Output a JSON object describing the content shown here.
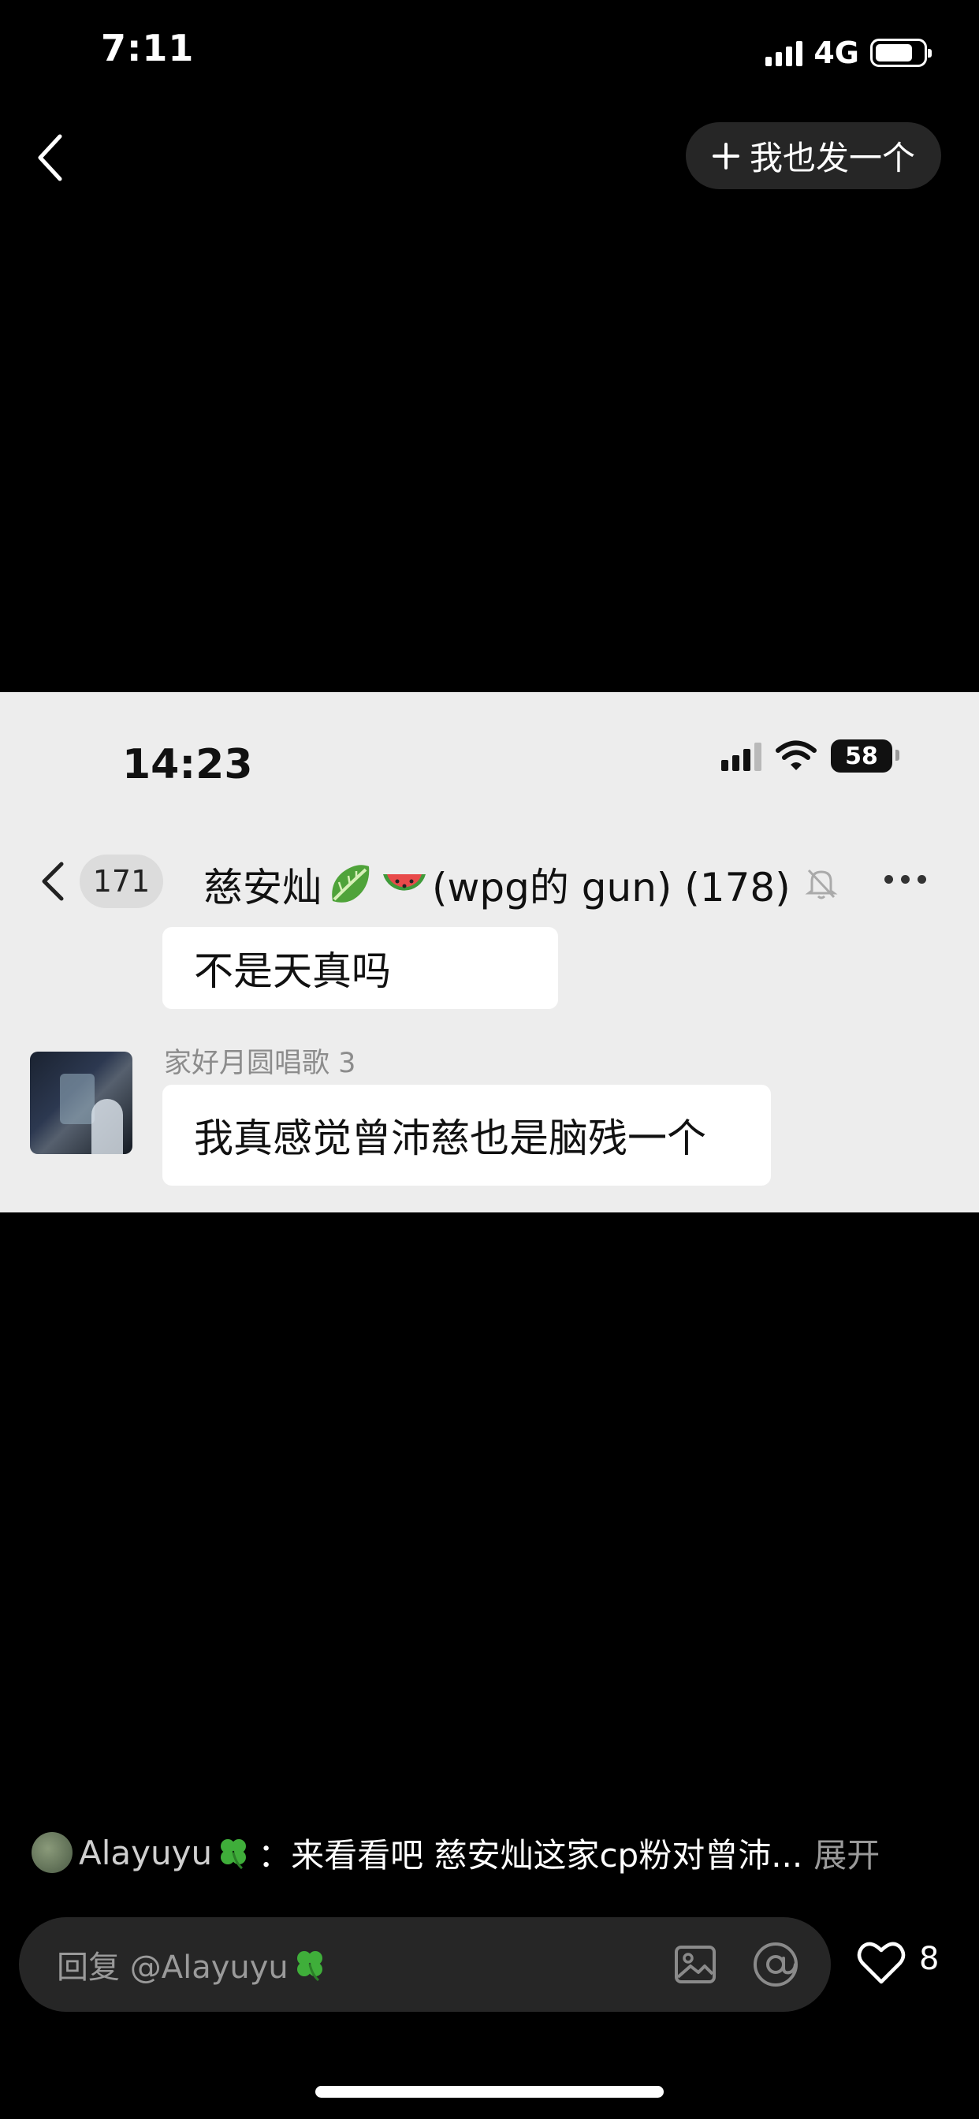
{
  "status_bar": {
    "time": "7:11",
    "network": "4G"
  },
  "nav": {
    "post_button_label": "我也发一个"
  },
  "screenshot": {
    "status": {
      "time": "14:23",
      "battery": "58"
    },
    "header": {
      "unread_count": "171",
      "group_name_prefix": "慈安灿",
      "group_name_suffix": "(wpg的 gun) (178)"
    },
    "messages": [
      {
        "text": "不是天真吗"
      },
      {
        "sender": "家好月圆唱歌 3",
        "text": "我真感觉曾沛慈也是脑残一个"
      }
    ]
  },
  "caption": {
    "username": "Alayuyu",
    "text": "：来看看吧 慈安灿这家cp粉对曾沛...",
    "expand_label": "展开"
  },
  "reply": {
    "placeholder_prefix": "回复 @Alayuyu"
  },
  "likes": {
    "count": "8"
  },
  "icons": [
    "back-icon",
    "plus-icon",
    "wifi-icon",
    "mute-bell-icon",
    "more-icon",
    "clover-icon",
    "image-icon",
    "at-icon",
    "heart-icon"
  ]
}
